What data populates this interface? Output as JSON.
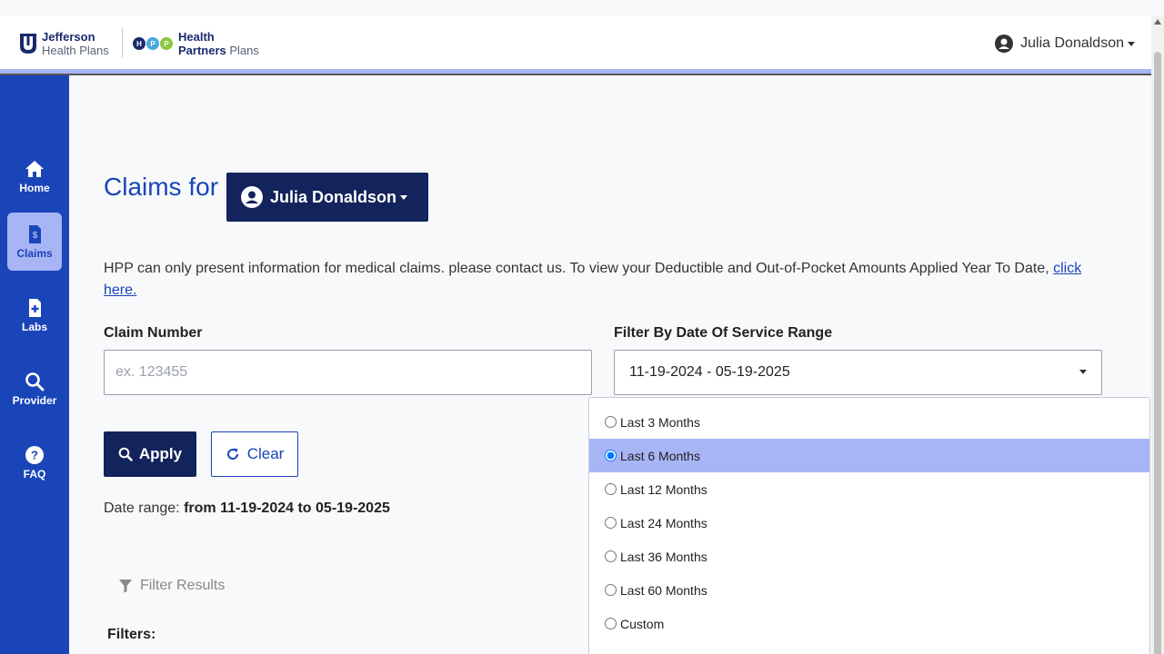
{
  "header": {
    "logo1_line1": "Jefferson",
    "logo1_line2": "Health Plans",
    "logo2_line1": "Health",
    "logo2_line2a": "Partners",
    "logo2_line2b": "Plans",
    "user_name": "Julia Donaldson"
  },
  "sidebar": {
    "items": [
      {
        "label": "Home",
        "icon": "home-icon"
      },
      {
        "label": "Claims",
        "icon": "claims-icon"
      },
      {
        "label": "Labs",
        "icon": "labs-icon"
      },
      {
        "label": "Provider",
        "icon": "search-icon"
      },
      {
        "label": "FAQ",
        "icon": "help-icon"
      }
    ],
    "active": "Claims"
  },
  "main": {
    "title": "Claims for",
    "member": "Julia Donaldson",
    "info_text": "HPP can only present information for medical claims. please contact us. To view your Deductible and Out-of-Pocket Amounts Applied Year To Date, ",
    "info_link": "click here.",
    "claim_label": "Claim Number",
    "claim_placeholder": "ex. 123455",
    "claim_value": "",
    "date_label": "Filter By Date Of Service Range",
    "date_value": "11-19-2024 - 05-19-2025",
    "apply_label": "Apply",
    "clear_label": "Clear",
    "range_prefix": "Date range:",
    "range_value": "from 11-19-2024 to 05-19-2025",
    "filter_results": "Filter Results",
    "filters_label": "Filters:"
  },
  "dropdown": {
    "options": [
      "Last 3 Months",
      "Last 6 Months",
      "Last 12 Months",
      "Last 24 Months",
      "Last 36 Months",
      "Last 60 Months",
      "Custom"
    ],
    "selected": "Last 6 Months"
  },
  "colors": {
    "sidebar": "#1a45b8",
    "accent_light": "#a8b5f5",
    "navy": "#13235b"
  }
}
